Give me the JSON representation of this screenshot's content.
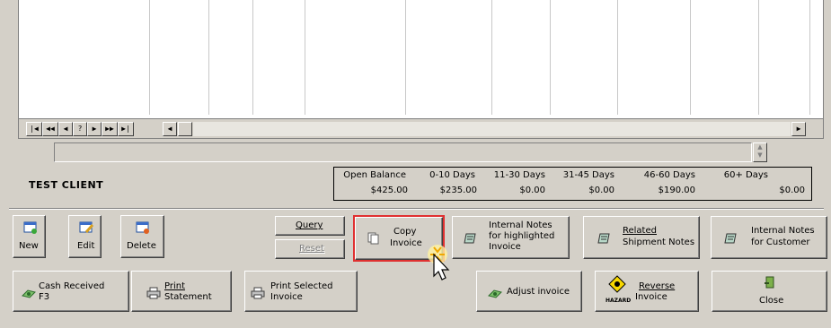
{
  "grid": {
    "nav_buttons": [
      "|◀",
      "◀◀",
      "◀",
      "?",
      "▶",
      "▶▶",
      "▶|"
    ],
    "scroll_left": "◀",
    "scroll_right": "▶"
  },
  "client": {
    "name": "TEST CLIENT"
  },
  "aging": {
    "headers": [
      "Open Balance",
      "0-10 Days",
      "11-30 Days",
      "31-45 Days",
      "46-60 Days",
      "60+ Days"
    ],
    "values": [
      "$425.00",
      "$235.00",
      "$0.00",
      "$0.00",
      "$190.00",
      "$0.00"
    ]
  },
  "buttons": {
    "new": "New",
    "edit": "Edit",
    "delete": "Delete",
    "query": "Query",
    "reset": "Reset",
    "copy_invoice_1": "Copy",
    "copy_invoice_2": "Invoice",
    "internal_notes_inv_1": "Internal Notes",
    "internal_notes_inv_2": "for highlighted",
    "internal_notes_inv_3": "Invoice",
    "related_1": "Related",
    "related_2": "Shipment Notes",
    "internal_notes_cust_1": "Internal Notes",
    "internal_notes_cust_2": "for Customer",
    "cash_received_1": "Cash Received",
    "cash_received_2": "F3",
    "print_statement_1": "Print",
    "print_statement_2": "Statement",
    "print_selected_1": "Print Selected",
    "print_selected_2": "Invoice",
    "adjust_invoice": "Adjust invoice",
    "reverse_1": "Reverse",
    "reverse_2": "Invoice",
    "hazard": "HAZARD",
    "close": "Close"
  },
  "colors": {
    "highlight_border": "#e03030",
    "face": "#d4d0c8"
  },
  "icons": {
    "new": "new-document-icon",
    "edit": "edit-document-icon",
    "delete": "delete-document-icon",
    "copy": "copy-icon",
    "notes": "note-icon",
    "cash": "money-icon",
    "print": "printer-icon",
    "hazard": "hazard-icon",
    "close": "door-exit-icon"
  }
}
